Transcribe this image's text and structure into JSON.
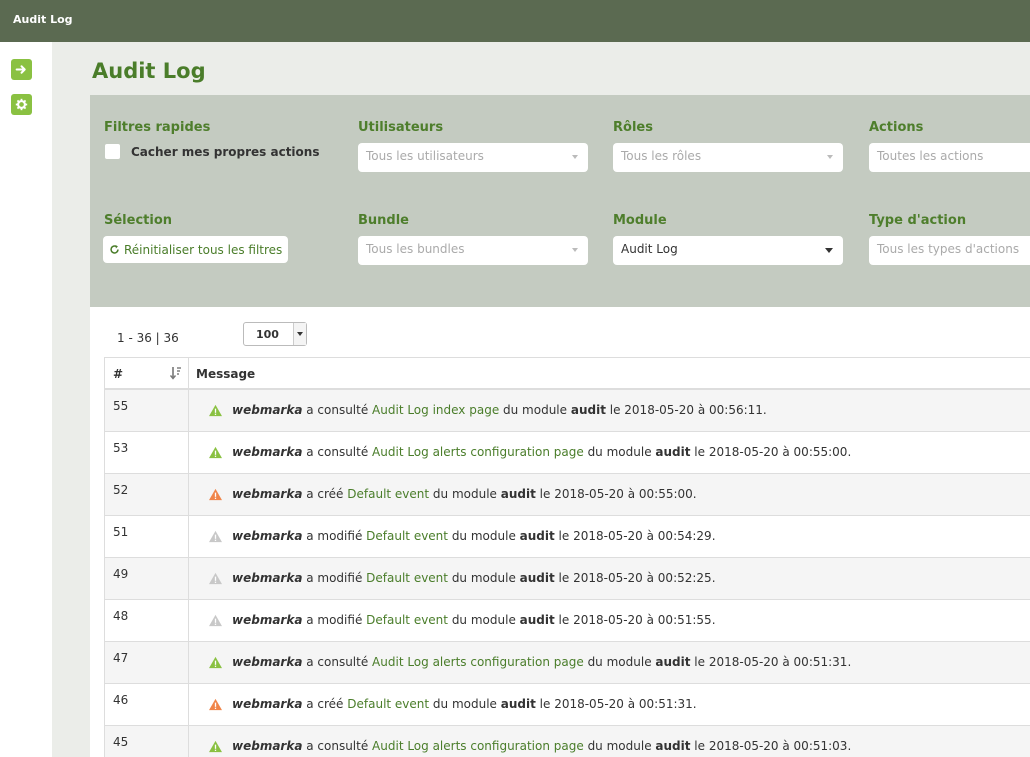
{
  "app": {
    "title": "Audit Log"
  },
  "page": {
    "title": "Audit Log"
  },
  "filters": {
    "quick": {
      "label": "Filtres rapides",
      "checkbox_label": "Cacher mes propres actions"
    },
    "users": {
      "label": "Utilisateurs",
      "placeholder": "Tous les utilisateurs"
    },
    "roles": {
      "label": "Rôles",
      "placeholder": "Tous les rôles"
    },
    "actions": {
      "label": "Actions",
      "placeholder": "Toutes les actions"
    },
    "selection": {
      "label": "Sélection",
      "reset_label": "Réinitialiser tous les filtres"
    },
    "bundle": {
      "label": "Bundle",
      "placeholder": "Tous les bundles"
    },
    "module": {
      "label": "Module",
      "value": "Audit Log"
    },
    "action_type": {
      "label": "Type d'action",
      "placeholder": "Tous les types d'actions"
    }
  },
  "results": {
    "count": "1 - 36 | 36",
    "per_page": "100",
    "columns": {
      "num": "#",
      "message": "Message"
    },
    "rows": [
      {
        "num": "55",
        "level": "green",
        "user": "webmarka",
        "verb": " a consulté ",
        "link": "Audit Log index page",
        "mid": " du module ",
        "module": "audit",
        "tail": " le 2018-05-20 à 00:56:11."
      },
      {
        "num": "53",
        "level": "green",
        "user": "webmarka",
        "verb": " a consulté ",
        "link": "Audit Log alerts configuration page",
        "mid": " du module ",
        "module": "audit",
        "tail": " le 2018-05-20 à 00:55:00."
      },
      {
        "num": "52",
        "level": "orange",
        "user": "webmarka",
        "verb": " a créé ",
        "link": "Default event",
        "mid": " du module ",
        "module": "audit",
        "tail": " le 2018-05-20 à 00:55:00."
      },
      {
        "num": "51",
        "level": "grey",
        "user": "webmarka",
        "verb": " a modifié ",
        "link": "Default event",
        "mid": " du module ",
        "module": "audit",
        "tail": " le 2018-05-20 à 00:54:29."
      },
      {
        "num": "49",
        "level": "grey",
        "user": "webmarka",
        "verb": " a modifié ",
        "link": "Default event",
        "mid": " du module ",
        "module": "audit",
        "tail": " le 2018-05-20 à 00:52:25."
      },
      {
        "num": "48",
        "level": "grey",
        "user": "webmarka",
        "verb": " a modifié ",
        "link": "Default event",
        "mid": " du module ",
        "module": "audit",
        "tail": " le 2018-05-20 à 00:51:55."
      },
      {
        "num": "47",
        "level": "green",
        "user": "webmarka",
        "verb": " a consulté ",
        "link": "Audit Log alerts configuration page",
        "mid": " du module ",
        "module": "audit",
        "tail": " le 2018-05-20 à 00:51:31."
      },
      {
        "num": "46",
        "level": "orange",
        "user": "webmarka",
        "verb": " a créé ",
        "link": "Default event",
        "mid": " du module ",
        "module": "audit",
        "tail": " le 2018-05-20 à 00:51:31."
      },
      {
        "num": "45",
        "level": "green",
        "user": "webmarka",
        "verb": " a consulté ",
        "link": "Audit Log alerts configuration page",
        "mid": " du module ",
        "module": "audit",
        "tail": " le 2018-05-20 à 00:51:03."
      }
    ]
  },
  "colors": {
    "green": "#8ac142",
    "orange": "#f0854a",
    "grey": "#c8c8c8",
    "accent": "#4a7d2a",
    "topbar": "#5b6a51"
  },
  "icons": {
    "nav": "arrow-right-icon",
    "settings": "gear-icon",
    "reset": "refresh-icon",
    "sort": "sort-icon",
    "level": "warning-triangle-icon"
  }
}
